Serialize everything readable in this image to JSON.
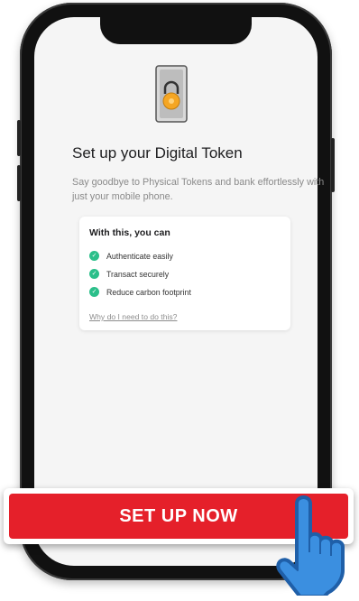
{
  "screen": {
    "title": "Set up your Digital Token",
    "subtitle": "Say goodbye to Physical Tokens and bank effortlessly with just your mobile phone.",
    "card": {
      "heading": "With this, you can",
      "benefits": [
        {
          "label": "Authenticate easily",
          "icon": "check-circle-icon"
        },
        {
          "label": "Transact securely",
          "icon": "check-circle-icon"
        },
        {
          "label": "Reduce carbon footprint",
          "icon": "check-circle-icon"
        }
      ],
      "link": "Why do I need to do this?"
    }
  },
  "cta": {
    "label": "SET UP NOW"
  },
  "icons": {
    "token": "padlock-token-icon",
    "cursor": "pointing-hand-icon"
  },
  "colors": {
    "cta_red": "#e5202a",
    "check_green": "#2bbf8a",
    "lock_orange": "#f5a623",
    "hand_blue": "#2a78c8"
  }
}
